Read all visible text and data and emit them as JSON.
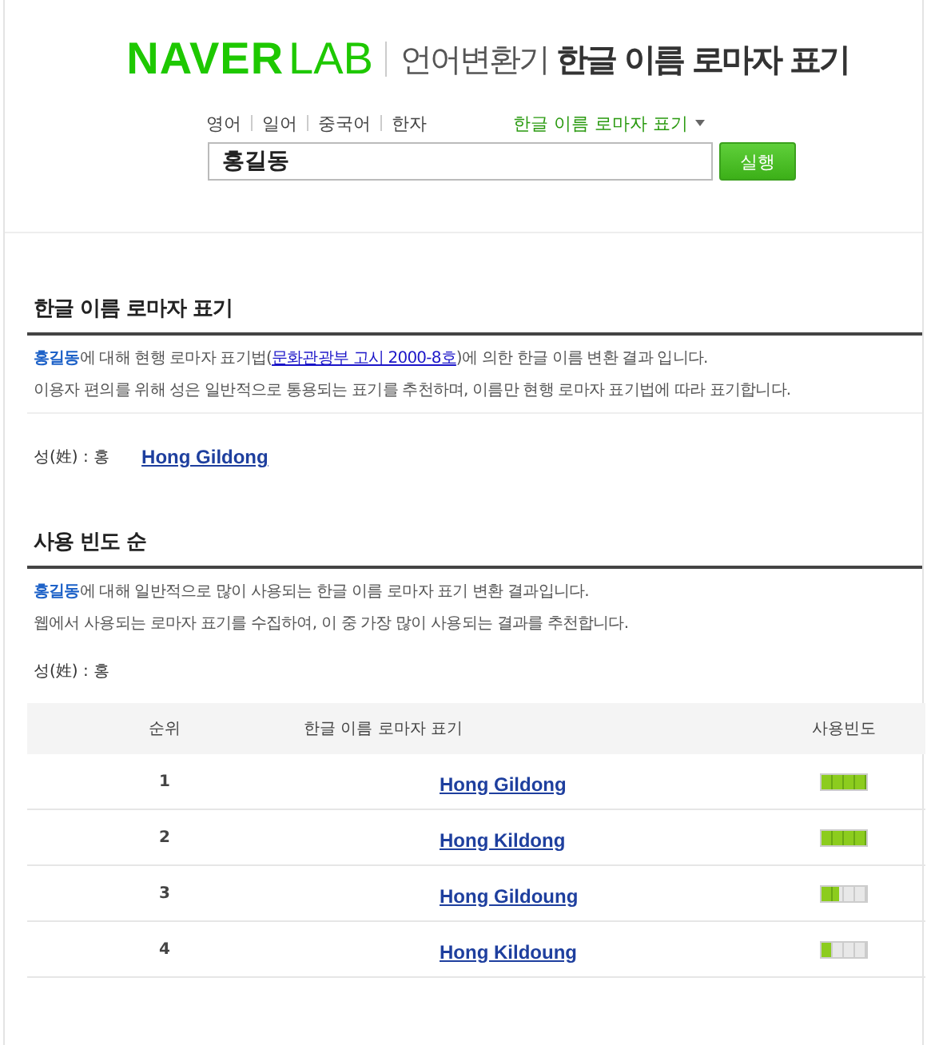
{
  "header": {
    "brand": "NAVER",
    "brand_sub": "LAB",
    "service": "언어변환기",
    "title": "한글 이름 로마자 표기"
  },
  "language_tabs": [
    {
      "label": "영어",
      "selected": false
    },
    {
      "label": "일어",
      "selected": false
    },
    {
      "label": "중국어",
      "selected": false
    },
    {
      "label": "한자",
      "selected": false
    }
  ],
  "mode_menu": {
    "label": "한글 이름 로마자 표기",
    "selected": true
  },
  "search": {
    "value": "홍길동",
    "button": "실행"
  },
  "official": {
    "title": "한글 이름 로마자 표기",
    "line1": {
      "before": "**홍길동**에 대해 현행 로마자 표기법(",
      "link": "문화관광부 고시 2000-8호",
      "after": ")에 의한 한글 이름 변환 결과 입니다."
    },
    "line2": "이용자 편의를 위해 성은 일반적으로 통용되는 표기를 추천하며, 이름만 현행 로마자 표기법에 따라 표기합니다.",
    "surname": "성(姓) : 홍",
    "result": "Hong Gildong"
  },
  "frequency": {
    "title": "사용 빈도 순",
    "line1": "**홍길동**에 대해 일반적으로 많이 사용되는 한글 이름 로마자 표기 변환 결과입니다.",
    "line2": "웹에서 사용되는 로마자 표기를 수집하여, 이 중 가장 많이 사용되는 결과를 추천합니다.",
    "surname": "성(姓) : 홍",
    "columns": [
      "순위",
      "한글 이름 로마자 표기",
      "사용빈도"
    ],
    "rows": [
      {
        "rank": "1",
        "name": "Hong Gildong",
        "level": 1
      },
      {
        "rank": "2",
        "name": "Hong Kildong",
        "level": 1
      },
      {
        "rank": "3",
        "name": "Hong Gildoung",
        "level": 0.4
      },
      {
        "rank": "4",
        "name": "Hong Kildoung",
        "level": 0.2
      }
    ]
  }
}
